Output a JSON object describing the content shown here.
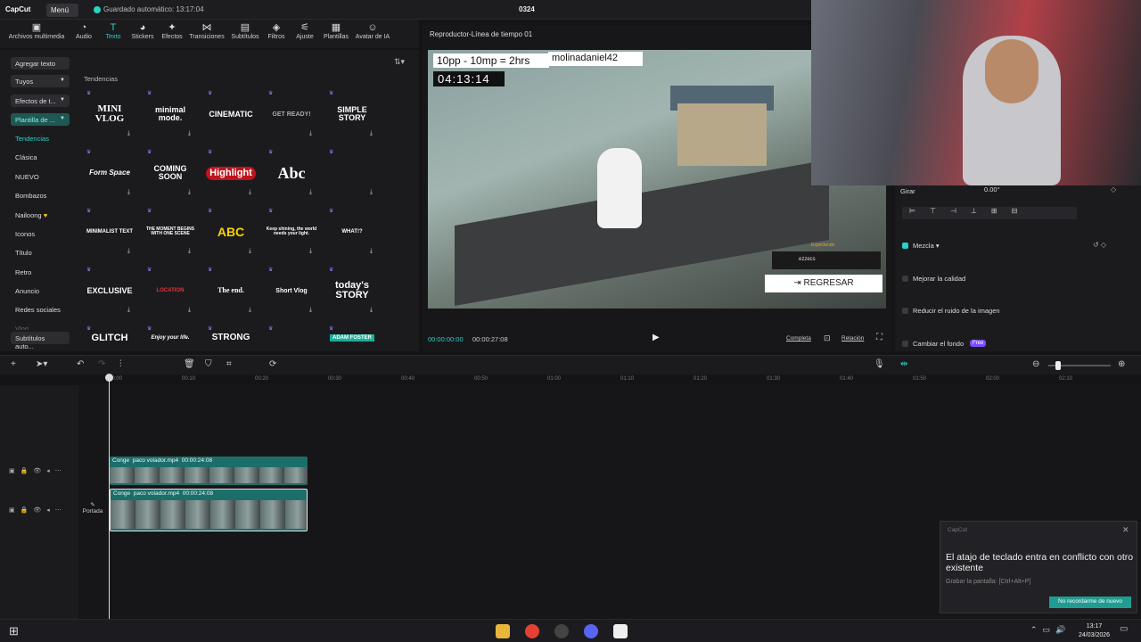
{
  "app": {
    "logo": "CapCut",
    "menu": "Menú",
    "autosave": "Guardado automático: 13:17:04",
    "project": "0324"
  },
  "toolbar": [
    {
      "icon": "media-icon",
      "label": "Archivos multimedia"
    },
    {
      "icon": "audio-icon",
      "label": "Audio"
    },
    {
      "icon": "text-icon",
      "label": "Texto"
    },
    {
      "icon": "stickers-icon",
      "label": "Stickers"
    },
    {
      "icon": "effects-icon",
      "label": "Efectos"
    },
    {
      "icon": "transitions-icon",
      "label": "Transiciones"
    },
    {
      "icon": "subtitles-icon",
      "label": "Subtítulos"
    },
    {
      "icon": "filters-icon",
      "label": "Filtros"
    },
    {
      "icon": "adjust-icon",
      "label": "Ajuste"
    },
    {
      "icon": "templates-icon",
      "label": "Plantillas"
    },
    {
      "icon": "ai-avatar-icon",
      "label": "Avatar de IA"
    }
  ],
  "sidebar": [
    "Agregar texto",
    "Tuyos",
    "Efectos de t...",
    "Plantilla de ...",
    "Tendencias",
    "Clásica",
    "NUEVO",
    "Bombazos",
    "Nailoong",
    "Iconos",
    "Título",
    "Retro",
    "Anuncio",
    "Redes sociales",
    "Vlog",
    "Subtítulos auto..."
  ],
  "grid": {
    "heading": "Tendencias",
    "tiles": [
      "MINI VLOG",
      "minimal mode.",
      "CINEMATIC",
      "GET READY!",
      "SIMPLE STORY",
      "Form Space",
      "COMING SOON",
      "Highlight",
      "Abc",
      "",
      "MINIMALIST TEXT",
      "THE MOMENT BEGINS WITH ONE SCENE",
      "ABC",
      "Keep shining, the world needs your light.",
      "WHAT!?",
      "EXCLUSIVE",
      "LOCATION",
      "The end.",
      "Short Vlog",
      "today's STORY",
      "GLITCH",
      "Enjoy your life.",
      "STRONG",
      "",
      "ADAM FOSTER"
    ]
  },
  "player": {
    "title": "Reproductor-Línea de tiempo 01",
    "overlay_text": "10pp - 10mp = 2hrs",
    "username": "molinadaniel42",
    "timer": "04:13:14",
    "spectating": "Espectando",
    "player_name": "ezzecs",
    "return_button": "REGRESAR",
    "current_time": "00:00:00:00",
    "total_time": "00:00:27:08",
    "full_label": "Completa",
    "ratio_label": "Relación"
  },
  "panel": {
    "rotate_label": "Girar",
    "rotate_value": "0.00°",
    "blend_label": "Mezcla",
    "quality_label": "Mejorar la calidad",
    "noise_label": "Reducir el ruido de la imagen",
    "bg_label": "Cambiar el fondo",
    "free_badge": "Free"
  },
  "ruler": [
    "00:00",
    "00:10",
    "00:20",
    "00:30",
    "00:40",
    "00:50",
    "01:00",
    "01:10",
    "01:20",
    "01:30",
    "01:40",
    "01:50",
    "02:00",
    "02:10"
  ],
  "clips": [
    {
      "name": "Conge",
      "file": "paco volador.mp4",
      "duration": "00:00:24:08"
    },
    {
      "name": "Conge",
      "file": "paco volador.mp4",
      "duration": "00:00:24:08"
    }
  ],
  "cover_label": "Portada",
  "toast": {
    "app": "CapCut",
    "message": "El atajo de teclado entra en conflicto con otro existente",
    "sub": "Grabar la pantalla: [Ctrl+Alt+P]",
    "button": "No recordarme de nuevo"
  },
  "clock": {
    "time": "13:17",
    "date": "24/03/2026"
  }
}
